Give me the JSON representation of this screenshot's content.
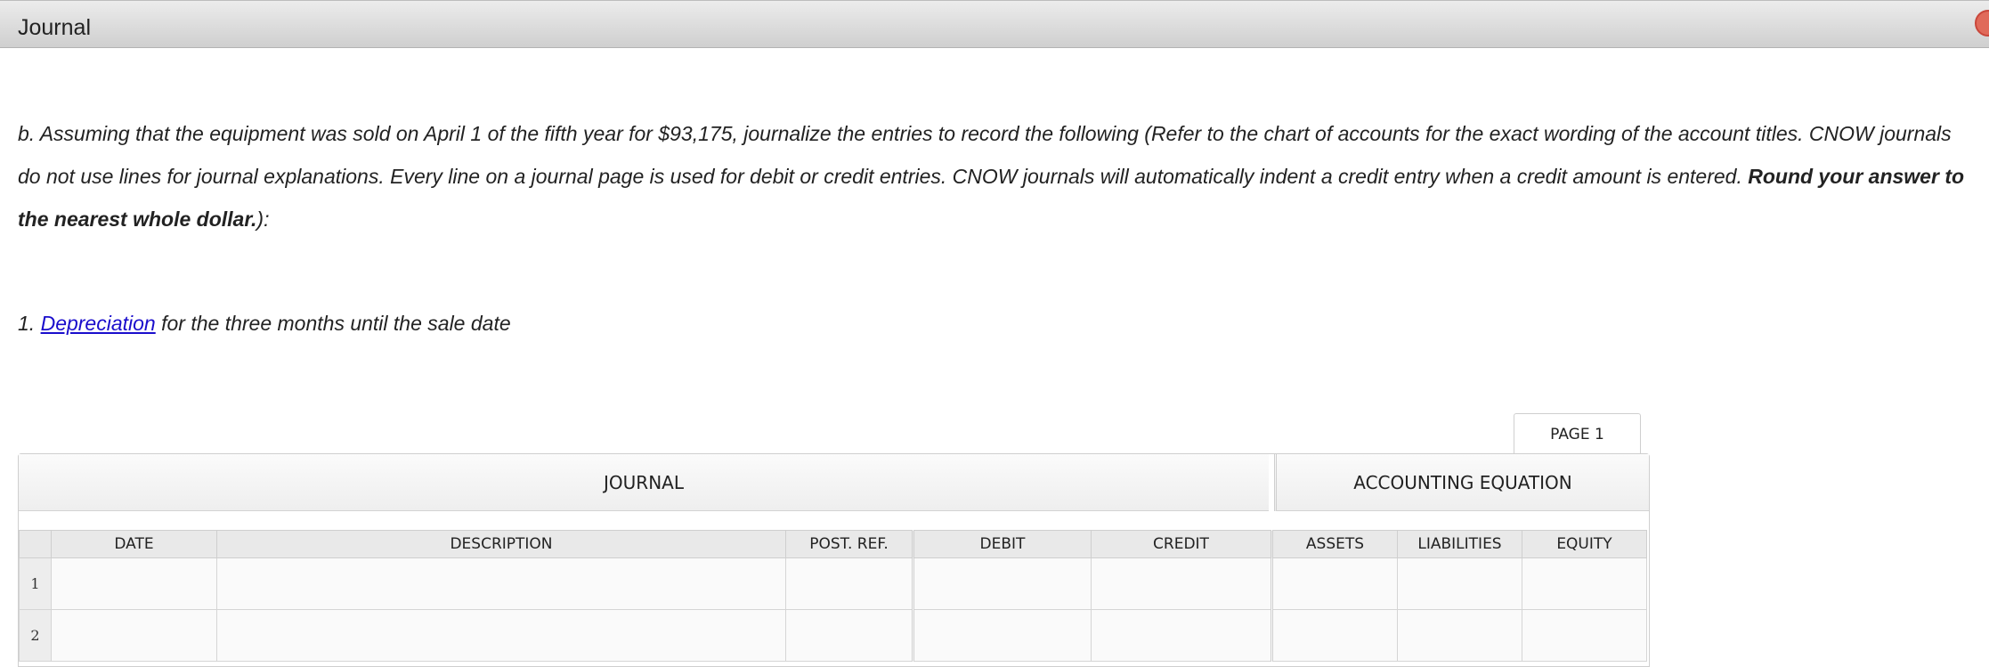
{
  "window": {
    "title": "Journal",
    "close_icon": "close-icon"
  },
  "instructions": {
    "text": "b. Assuming that the equipment was sold on April 1 of the fifth year for $93,175, journalize the entries to record the following (Refer to the chart of accounts for the exact wording of the account titles. CNOW journals do not use lines for journal explanations. Every line on a journal page is used for debit or credit entries. CNOW journals will automatically indent a credit entry when a credit amount is entered. ",
    "bold": "Round your answer to the nearest whole dollar.",
    "tail": "):"
  },
  "question": {
    "number": "1.",
    "link": "Depreciation",
    "text": " for the three months until the sale date"
  },
  "journal": {
    "page_label": "PAGE 1",
    "section_journal": "JOURNAL",
    "section_equation": "ACCOUNTING EQUATION",
    "columns": {
      "date": "DATE",
      "description": "DESCRIPTION",
      "post_ref": "POST. REF.",
      "debit": "DEBIT",
      "credit": "CREDIT",
      "assets": "ASSETS",
      "liabilities": "LIABILITIES",
      "equity": "EQUITY"
    },
    "rows": [
      {
        "num": "1"
      },
      {
        "num": "2"
      }
    ]
  }
}
